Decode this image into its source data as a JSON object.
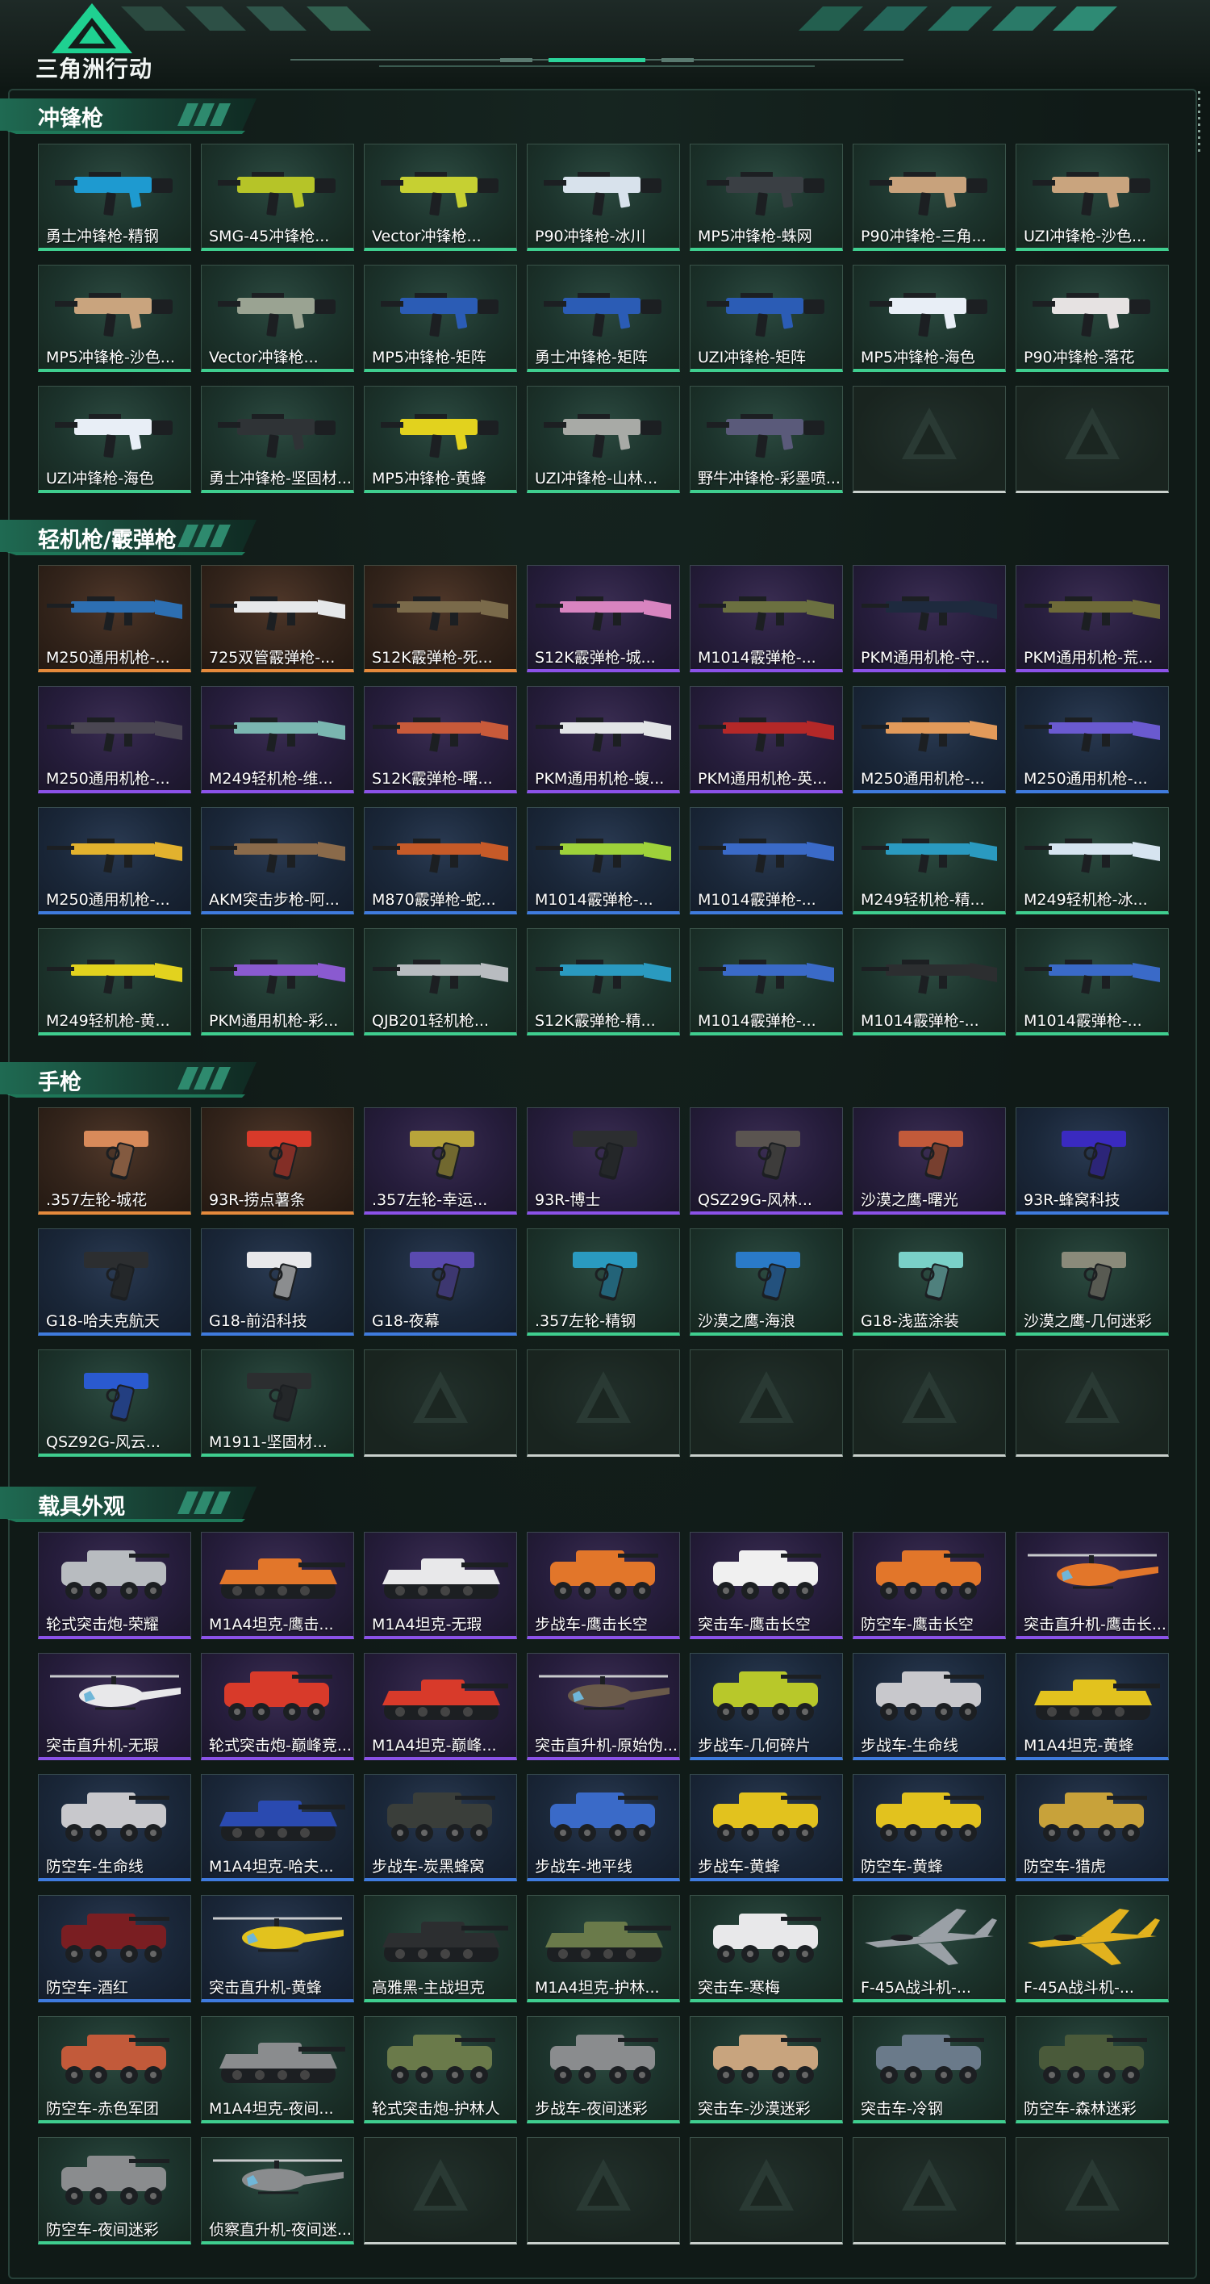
{
  "app": {
    "title": "三角洲行动"
  },
  "colors": {
    "common": "#3fce8f",
    "rare": "#3f7bde",
    "epic": "#8b52e8",
    "legendary": "#e58a3c",
    "accent": "#25c088"
  },
  "sections": [
    {
      "title": "冲锋枪",
      "items": [
        {
          "name": "勇士冲锋枪-精钢",
          "rarity": "green",
          "icon": "smg",
          "tint": "#1e9ad0"
        },
        {
          "name": "SMG-45冲锋枪...",
          "rarity": "green",
          "icon": "smg",
          "tint": "#b6c428"
        },
        {
          "name": "Vector冲锋枪...",
          "rarity": "green",
          "icon": "smg",
          "tint": "#c6d032"
        },
        {
          "name": "P90冲锋枪-冰川",
          "rarity": "green",
          "icon": "smg",
          "tint": "#d8e2ec"
        },
        {
          "name": "MP5冲锋枪-蛛网",
          "rarity": "green",
          "icon": "smg",
          "tint": "#3a3f44"
        },
        {
          "name": "P90冲锋枪-三角...",
          "rarity": "green",
          "icon": "smg",
          "tint": "#c8a27c"
        },
        {
          "name": "UZI冲锋枪-沙色...",
          "rarity": "green",
          "icon": "smg",
          "tint": "#c9a47e"
        },
        {
          "name": "MP5冲锋枪-沙色...",
          "rarity": "green",
          "icon": "smg",
          "tint": "#c9a47e"
        },
        {
          "name": "Vector冲锋枪...",
          "rarity": "green",
          "icon": "smg",
          "tint": "#9aa392"
        },
        {
          "name": "MP5冲锋枪-矩阵",
          "rarity": "green",
          "icon": "smg",
          "tint": "#2b5cb5"
        },
        {
          "name": "勇士冲锋枪-矩阵",
          "rarity": "green",
          "icon": "smg",
          "tint": "#2b5cb5"
        },
        {
          "name": "UZI冲锋枪-矩阵",
          "rarity": "green",
          "icon": "smg",
          "tint": "#2b5cb5"
        },
        {
          "name": "MP5冲锋枪-海色",
          "rarity": "green",
          "icon": "smg",
          "tint": "#e8eef6"
        },
        {
          "name": "P90冲锋枪-落花",
          "rarity": "green",
          "icon": "smg",
          "tint": "#e6e2e2"
        },
        {
          "name": "UZI冲锋枪-海色",
          "rarity": "green",
          "icon": "smg",
          "tint": "#e8eef6"
        },
        {
          "name": "勇士冲锋枪-坚固材...",
          "rarity": "green",
          "icon": "smg",
          "tint": "#2f3336"
        },
        {
          "name": "MP5冲锋枪-黄蜂",
          "rarity": "green",
          "icon": "smg",
          "tint": "#e2d21e"
        },
        {
          "name": "UZI冲锋枪-山林...",
          "rarity": "green",
          "icon": "smg",
          "tint": "#a8aaa6"
        },
        {
          "name": "野牛冲锋枪-彩墨喷...",
          "rarity": "green",
          "icon": "smg",
          "tint": "#5a5a7a"
        },
        {
          "empty": true
        },
        {
          "empty": true
        }
      ]
    },
    {
      "title": "轻机枪/霰弹枪",
      "items": [
        {
          "name": "M250通用机枪-...",
          "rarity": "orange",
          "icon": "rifle",
          "tint": "#2d6fb2"
        },
        {
          "name": "725双管霰弹枪-...",
          "rarity": "orange",
          "icon": "rifle",
          "tint": "#e6e8ea"
        },
        {
          "name": "S12K霰弹枪-死...",
          "rarity": "orange",
          "icon": "rifle",
          "tint": "#7a6a4a"
        },
        {
          "name": "S12K霰弹枪-城...",
          "rarity": "purple",
          "icon": "rifle",
          "tint": "#d884c0"
        },
        {
          "name": "M1014霰弹枪-...",
          "rarity": "purple",
          "icon": "rifle",
          "tint": "#6b7040"
        },
        {
          "name": "PKM通用机枪-守...",
          "rarity": "purple",
          "icon": "rifle",
          "tint": "#1e2a3e"
        },
        {
          "name": "PKM通用机枪-荒...",
          "rarity": "purple",
          "icon": "rifle",
          "tint": "#6e6a38"
        },
        {
          "name": "M250通用机枪-...",
          "rarity": "purple",
          "icon": "rifle",
          "tint": "#4a4652"
        },
        {
          "name": "M249轻机枪-维...",
          "rarity": "purple",
          "icon": "rifle",
          "tint": "#7ab6b0"
        },
        {
          "name": "S12K霰弹枪-曙...",
          "rarity": "purple",
          "icon": "rifle",
          "tint": "#c85a3a"
        },
        {
          "name": "PKM通用机枪-蝮...",
          "rarity": "purple",
          "icon": "rifle",
          "tint": "#e2e4e6"
        },
        {
          "name": "PKM通用机枪-英...",
          "rarity": "purple",
          "icon": "rifle",
          "tint": "#b42828"
        },
        {
          "name": "M250通用机枪-...",
          "rarity": "blue",
          "icon": "rifle",
          "tint": "#e29a5a"
        },
        {
          "name": "M250通用机枪-...",
          "rarity": "blue",
          "icon": "rifle",
          "tint": "#6a5ad0"
        },
        {
          "name": "M250通用机枪-...",
          "rarity": "blue",
          "icon": "rifle",
          "tint": "#e2b22e"
        },
        {
          "name": "AKM突击步枪-阿...",
          "rarity": "blue",
          "icon": "rifle",
          "tint": "#8a6a4a"
        },
        {
          "name": "M870霰弹枪-蛇...",
          "rarity": "blue",
          "icon": "rifle",
          "tint": "#c65a28"
        },
        {
          "name": "M1014霰弹枪-...",
          "rarity": "blue",
          "icon": "rifle",
          "tint": "#9ed23a"
        },
        {
          "name": "M1014霰弹枪-...",
          "rarity": "blue",
          "icon": "rifle",
          "tint": "#3a6ac8"
        },
        {
          "name": "M249轻机枪-精...",
          "rarity": "green",
          "icon": "rifle",
          "tint": "#2a9ac0"
        },
        {
          "name": "M249轻机枪-冰...",
          "rarity": "green",
          "icon": "rifle",
          "tint": "#d6e4f0"
        },
        {
          "name": "M249轻机枪-黄...",
          "rarity": "green",
          "icon": "rifle",
          "tint": "#e2d21e"
        },
        {
          "name": "PKM通用机枪-彩...",
          "rarity": "green",
          "icon": "rifle",
          "tint": "#8a5ad0"
        },
        {
          "name": "QJB201轻机枪...",
          "rarity": "green",
          "icon": "rifle",
          "tint": "#b8bcc0"
        },
        {
          "name": "S12K霰弹枪-精...",
          "rarity": "green",
          "icon": "rifle",
          "tint": "#2a9ac0"
        },
        {
          "name": "M1014霰弹枪-...",
          "rarity": "green",
          "icon": "rifle",
          "tint": "#3a6ac8"
        },
        {
          "name": "M1014霰弹枪-...",
          "rarity": "green",
          "icon": "rifle",
          "tint": "#2c2e30"
        },
        {
          "name": "M1014霰弹枪-...",
          "rarity": "green",
          "icon": "rifle",
          "tint": "#3a6ac8"
        }
      ]
    },
    {
      "title": "手枪",
      "items": [
        {
          "name": ".357左轮-城花",
          "rarity": "orange",
          "icon": "pistol",
          "tint": "#d88a5a"
        },
        {
          "name": "93R-捞点薯条",
          "rarity": "orange",
          "icon": "pistol",
          "tint": "#d83a2a"
        },
        {
          "name": ".357左轮-幸运...",
          "rarity": "purple",
          "icon": "pistol",
          "tint": "#b8a43a"
        },
        {
          "name": "93R-博士",
          "rarity": "purple",
          "icon": "pistol",
          "tint": "#2c2e30"
        },
        {
          "name": "QSZ29G-风林...",
          "rarity": "purple",
          "icon": "pistol",
          "tint": "#5a5450"
        },
        {
          "name": "沙漠之鹰-曙光",
          "rarity": "purple",
          "icon": "pistol",
          "tint": "#c25a3a"
        },
        {
          "name": "93R-蜂窝科技",
          "rarity": "blue",
          "icon": "pistol",
          "tint": "#3a2ac0"
        },
        {
          "name": "G18-哈夫克航天",
          "rarity": "blue",
          "icon": "pistol",
          "tint": "#2c2e30"
        },
        {
          "name": "G18-前沿科技",
          "rarity": "blue",
          "icon": "pistol",
          "tint": "#e8e8ea"
        },
        {
          "name": "G18-夜幕",
          "rarity": "blue",
          "icon": "pistol",
          "tint": "#5a4ab0"
        },
        {
          "name": ".357左轮-精钢",
          "rarity": "green",
          "icon": "pistol",
          "tint": "#2a9ac0"
        },
        {
          "name": "沙漠之鹰-海浪",
          "rarity": "green",
          "icon": "pistol",
          "tint": "#2a7ac8"
        },
        {
          "name": "G18-浅蓝涂装",
          "rarity": "green",
          "icon": "pistol",
          "tint": "#7ad0c8"
        },
        {
          "name": "沙漠之鹰-几何迷彩",
          "rarity": "green",
          "icon": "pistol",
          "tint": "#8a8a7a"
        },
        {
          "name": "QSZ92G-风云...",
          "rarity": "green",
          "icon": "pistol",
          "tint": "#2a5ad0"
        },
        {
          "name": "M1911-坚固材...",
          "rarity": "green",
          "icon": "pistol",
          "tint": "#2c2e30"
        },
        {
          "empty": true
        },
        {
          "empty": true
        },
        {
          "empty": true
        },
        {
          "empty": true
        },
        {
          "empty": true
        }
      ]
    },
    {
      "title": "载具外观",
      "items": [
        {
          "name": "轮式突击炮-荣耀",
          "rarity": "purple",
          "icon": "vehicle",
          "tint": "#b8bcc0"
        },
        {
          "name": "M1A4坦克-鹰击...",
          "rarity": "purple",
          "icon": "tank",
          "tint": "#e2762a"
        },
        {
          "name": "M1A4坦克-无瑕",
          "rarity": "purple",
          "icon": "tank",
          "tint": "#e8e8ea"
        },
        {
          "name": "步战车-鹰击长空",
          "rarity": "purple",
          "icon": "vehicle",
          "tint": "#e2762a"
        },
        {
          "name": "突击车-鹰击长空",
          "rarity": "purple",
          "icon": "vehicle",
          "tint": "#f0f0f0"
        },
        {
          "name": "防空车-鹰击长空",
          "rarity": "purple",
          "icon": "vehicle",
          "tint": "#e2762a"
        },
        {
          "name": "突击直升机-鹰击长...",
          "rarity": "purple",
          "icon": "heli",
          "tint": "#e2762a"
        },
        {
          "name": "突击直升机-无瑕",
          "rarity": "purple",
          "icon": "heli",
          "tint": "#e8e8ea"
        },
        {
          "name": "轮式突击炮-巅峰竞...",
          "rarity": "purple",
          "icon": "vehicle",
          "tint": "#d83a2a"
        },
        {
          "name": "M1A4坦克-巅峰...",
          "rarity": "purple",
          "icon": "tank",
          "tint": "#d83a2a"
        },
        {
          "name": "突击直升机-原始伪...",
          "rarity": "purple",
          "icon": "heli",
          "tint": "#6a5a4a"
        },
        {
          "name": "步战车-几何碎片",
          "rarity": "blue",
          "icon": "vehicle",
          "tint": "#b8c82a"
        },
        {
          "name": "步战车-生命线",
          "rarity": "blue",
          "icon": "vehicle",
          "tint": "#c8c8cc"
        },
        {
          "name": "M1A4坦克-黄蜂",
          "rarity": "blue",
          "icon": "tank",
          "tint": "#e2c21e"
        },
        {
          "name": "防空车-生命线",
          "rarity": "blue",
          "icon": "vehicle",
          "tint": "#c8c8cc"
        },
        {
          "name": "M1A4坦克-哈夫...",
          "rarity": "blue",
          "icon": "tank",
          "tint": "#2a4ab0"
        },
        {
          "name": "步战车-炭黑蜂窝",
          "rarity": "blue",
          "icon": "vehicle",
          "tint": "#3a3e3a"
        },
        {
          "name": "步战车-地平线",
          "rarity": "blue",
          "icon": "vehicle",
          "tint": "#3a6ac8"
        },
        {
          "name": "步战车-黄蜂",
          "rarity": "blue",
          "icon": "vehicle",
          "tint": "#e2c21e"
        },
        {
          "name": "防空车-黄蜂",
          "rarity": "blue",
          "icon": "vehicle",
          "tint": "#e2c21e"
        },
        {
          "name": "防空车-猎虎",
          "rarity": "blue",
          "icon": "vehicle",
          "tint": "#c8a23a"
        },
        {
          "name": "防空车-酒红",
          "rarity": "blue",
          "icon": "vehicle",
          "tint": "#7a1e22"
        },
        {
          "name": "突击直升机-黄蜂",
          "rarity": "blue",
          "icon": "heli",
          "tint": "#e2c21e"
        },
        {
          "name": "高雅黑-主战坦克",
          "rarity": "green",
          "icon": "tank",
          "tint": "#2c2e30"
        },
        {
          "name": "M1A4坦克-护林...",
          "rarity": "green",
          "icon": "tank",
          "tint": "#6a7a4a"
        },
        {
          "name": "突击车-寒梅",
          "rarity": "green",
          "icon": "vehicle",
          "tint": "#e8e8ea"
        },
        {
          "name": "F-45A战斗机-...",
          "rarity": "green",
          "icon": "jet",
          "tint": "#9aa0a6"
        },
        {
          "name": "F-45A战斗机-...",
          "rarity": "green",
          "icon": "jet",
          "tint": "#e2b21e"
        },
        {
          "name": "防空车-赤色军团",
          "rarity": "green",
          "icon": "vehicle",
          "tint": "#c25a3a"
        },
        {
          "name": "M1A4坦克-夜间...",
          "rarity": "green",
          "icon": "tank",
          "tint": "#8a8c8e"
        },
        {
          "name": "轮式突击炮-护林人",
          "rarity": "green",
          "icon": "vehicle",
          "tint": "#6a7a4a"
        },
        {
          "name": "步战车-夜间迷彩",
          "rarity": "green",
          "icon": "vehicle",
          "tint": "#8a8c8e"
        },
        {
          "name": "突击车-沙漠迷彩",
          "rarity": "green",
          "icon": "vehicle",
          "tint": "#c8a47e"
        },
        {
          "name": "突击车-冷钢",
          "rarity": "green",
          "icon": "vehicle",
          "tint": "#6a7a8a"
        },
        {
          "name": "防空车-森林迷彩",
          "rarity": "green",
          "icon": "vehicle",
          "tint": "#4a5a3a"
        },
        {
          "name": "防空车-夜间迷彩",
          "rarity": "green",
          "icon": "vehicle",
          "tint": "#8a8c8e"
        },
        {
          "name": "侦察直升机-夜间迷...",
          "rarity": "green",
          "icon": "heli",
          "tint": "#8a8c8e"
        },
        {
          "empty": true
        },
        {
          "empty": true
        },
        {
          "empty": true
        },
        {
          "empty": true
        },
        {
          "empty": true
        }
      ]
    }
  ]
}
